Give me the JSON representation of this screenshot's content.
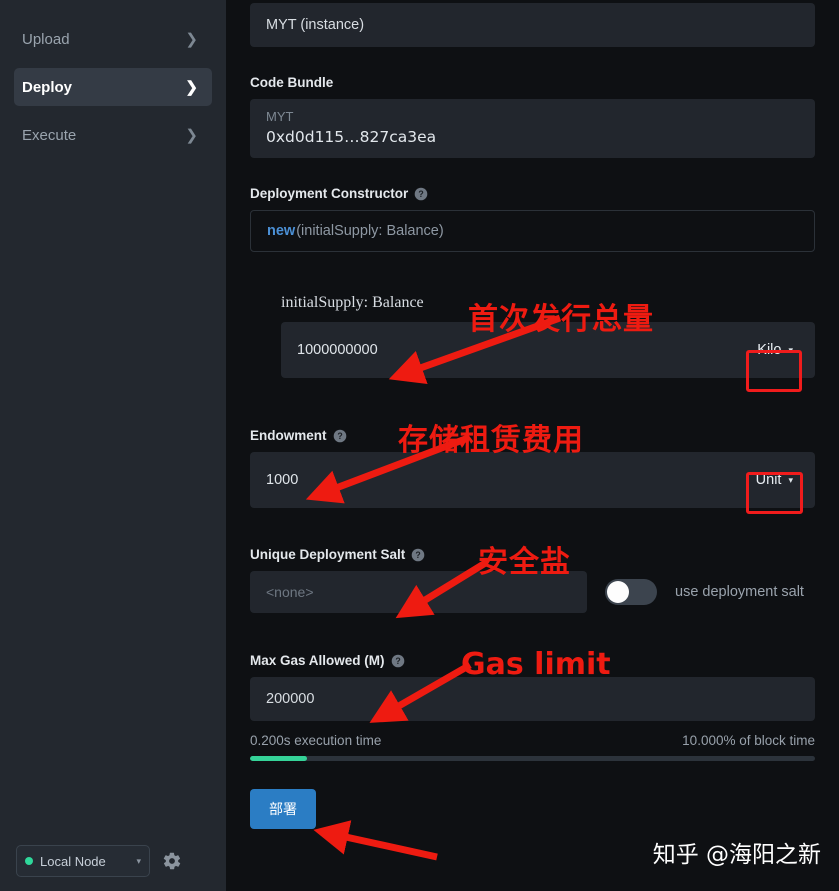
{
  "sidebar": {
    "items": [
      {
        "label": "Upload",
        "active": false,
        "icon": "chevron-right-icon"
      },
      {
        "label": "Deploy",
        "active": true,
        "icon": "chevron-right-icon"
      },
      {
        "label": "Execute",
        "active": false,
        "icon": "chevron-right-icon"
      }
    ],
    "footer": {
      "node_label": "Local Node",
      "node_status_color": "#2fd89b",
      "caret": "▾",
      "settings_icon": "gear-icon"
    }
  },
  "main": {
    "instance_field": {
      "value": "MYT (instance)"
    },
    "code_bundle": {
      "label": "Code Bundle",
      "name": "MYT",
      "hash": "0xd0d115…827ca3ea"
    },
    "deployment_constructor": {
      "label": "Deployment Constructor",
      "help_icon": "help-circle-icon",
      "keyword": "new",
      "signature": "(initialSupply: Balance)"
    },
    "initial_supply": {
      "param_label": "initialSupply: Balance",
      "value": "1000000000",
      "unit": "Kilo",
      "unit_caret": "▾"
    },
    "endowment": {
      "label": "Endowment",
      "help_icon": "help-circle-icon",
      "value": "1000",
      "unit": "Unit",
      "unit_caret": "▾"
    },
    "salt": {
      "label": "Unique Deployment Salt",
      "help_icon": "help-circle-icon",
      "placeholder": "<none>",
      "toggle_label": "use deployment salt",
      "toggle_on": false
    },
    "max_gas": {
      "label": "Max Gas Allowed (M)",
      "help_icon": "help-circle-icon",
      "value": "200000",
      "execution_time": "0.200s execution time",
      "block_time_pct": "10.000% of block time",
      "progress_percent": 10,
      "progress_color": "#35d398"
    },
    "deploy_button": {
      "label": "部署",
      "color": "#2b7dc4"
    }
  },
  "annotations": {
    "color": "#ee1b11",
    "items": [
      {
        "text": "首次发行总量",
        "name": "annotation-initial-supply"
      },
      {
        "text": "存储租赁费用",
        "name": "annotation-endowment"
      },
      {
        "text": "安全盐",
        "name": "annotation-salt"
      },
      {
        "text": "Gas limit",
        "name": "annotation-gas-limit"
      }
    ]
  },
  "watermark": {
    "text": "知乎 @海阳之新"
  }
}
